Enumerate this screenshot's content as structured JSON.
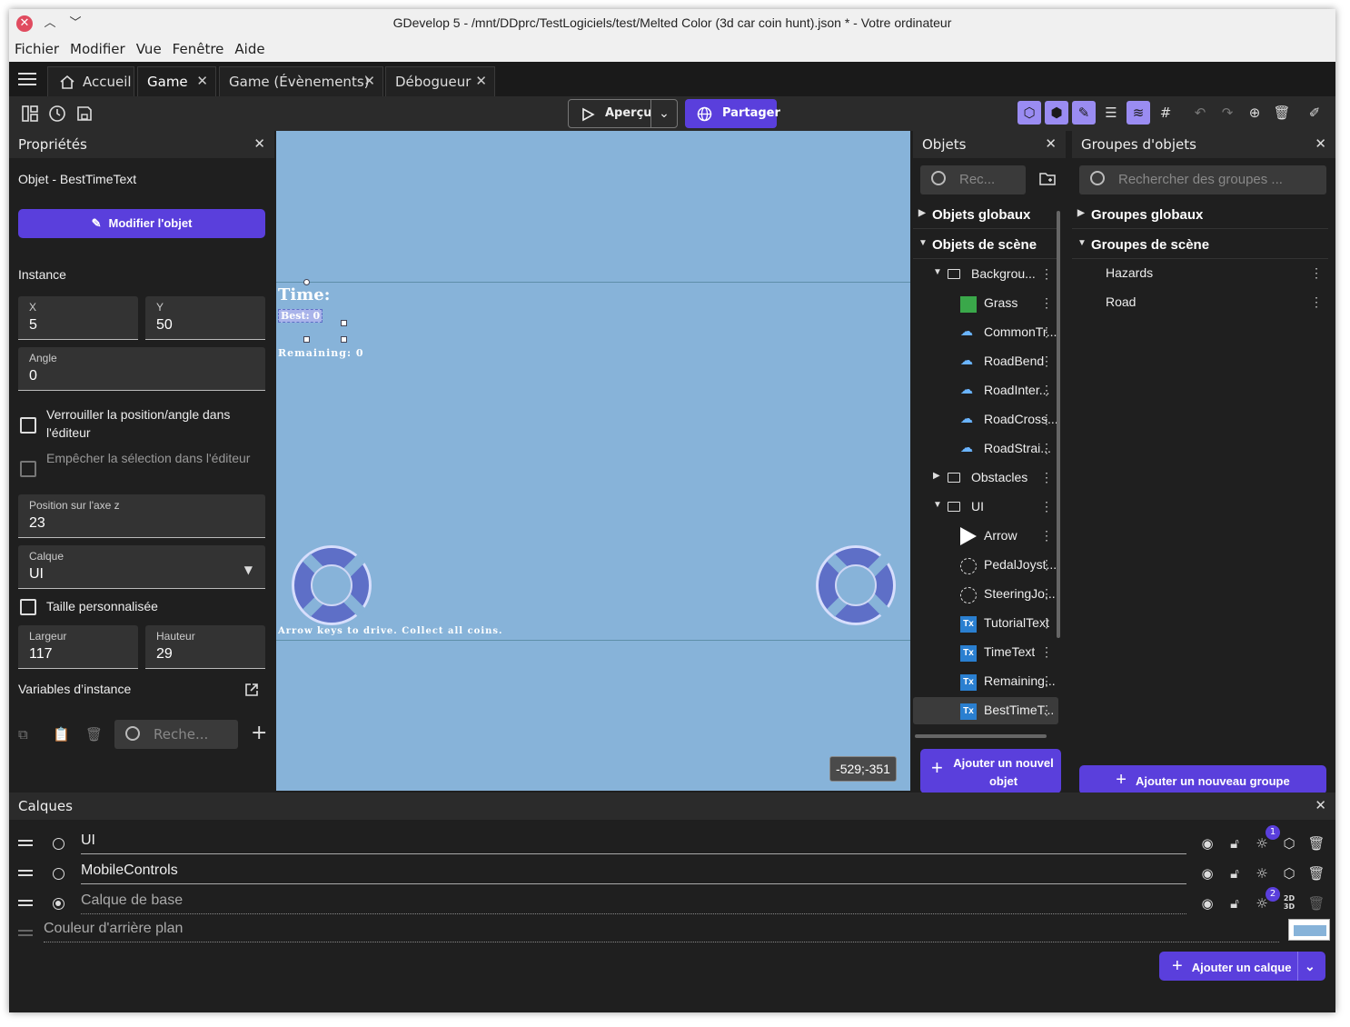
{
  "window": {
    "title": "GDevelop 5 - /mnt/DDprc/TestLogiciels/test/Melted Color (3d car coin hunt).json * - Votre ordinateur"
  },
  "menu": [
    "Fichier",
    "Modifier",
    "Vue",
    "Fenêtre",
    "Aide"
  ],
  "tabs": [
    {
      "label": "Accueil"
    },
    {
      "label": "Game"
    },
    {
      "label": "Game (Évènements)"
    },
    {
      "label": "Débogueur"
    }
  ],
  "toolbar": {
    "preview_label": "Aperçu",
    "share_label": "Partager"
  },
  "properties": {
    "header": "Propriétés",
    "object_line": "Objet  - BestTimeText",
    "edit_object_label": "Modifier l'objet",
    "instance_label": "Instance",
    "x_label": "X",
    "x_value": "5",
    "y_label": "Y",
    "y_value": "50",
    "angle_label": "Angle",
    "angle_value": "0",
    "lock_label": "Verrouiller la position/angle dans l'éditeur",
    "prevent_select_label": "Empêcher la sélection dans l'éditeur",
    "z_label": "Position sur l'axe z",
    "z_value": "23",
    "layer_label": "Calque",
    "layer_value": "UI",
    "custom_size_label": "Taille personnalisée",
    "width_label": "Largeur",
    "width_value": "117",
    "height_label": "Hauteur",
    "height_value": "29",
    "instance_vars_label": "Variables d’instance",
    "search_placeholder": "Reche..."
  },
  "canvas": {
    "time_text": "Time:",
    "best_text": "Best: 0",
    "remaining_text": "Remaining: 0",
    "tutorial_text": "Arrow keys to drive. Collect all coins.",
    "coords": "-529;-351",
    "background_color": "#87b3d9"
  },
  "objects": {
    "header": "Objets",
    "search_placeholder": "Rec...",
    "global_label": "Objets globaux",
    "scene_label": "Objets de scène",
    "items": [
      {
        "label": "Backgrou...",
        "kind": "folder"
      },
      {
        "label": "Grass",
        "kind": "grass-icon"
      },
      {
        "label": "CommonTr...",
        "kind": "model-icon"
      },
      {
        "label": "RoadBend",
        "kind": "model-icon"
      },
      {
        "label": "RoadInter...",
        "kind": "model-icon"
      },
      {
        "label": "RoadCross...",
        "kind": "model-icon"
      },
      {
        "label": "RoadStrai...",
        "kind": "model-icon"
      },
      {
        "label": "Obstacles",
        "kind": "folder"
      },
      {
        "label": "UI",
        "kind": "folder"
      },
      {
        "label": "Arrow",
        "kind": "arrow-icon"
      },
      {
        "label": "PedalJoyst...",
        "kind": "joystick-icon"
      },
      {
        "label": "SteeringJo...",
        "kind": "joystick-icon"
      },
      {
        "label": "TutorialText",
        "kind": "text-icon"
      },
      {
        "label": "TimeText",
        "kind": "text-icon"
      },
      {
        "label": "Remaining...",
        "kind": "text-icon"
      },
      {
        "label": "BestTimeT...",
        "kind": "text-icon"
      }
    ],
    "add_label_1": "Ajouter un nouvel",
    "add_label_2": "objet"
  },
  "groups": {
    "header": "Groupes d'objets",
    "search_placeholder": "Rechercher des groupes ...",
    "global_label": "Groupes globaux",
    "scene_label": "Groupes de scène",
    "items": [
      {
        "label": "Hazards"
      },
      {
        "label": "Road"
      }
    ],
    "add_label": "Ajouter un nouveau groupe"
  },
  "layers": {
    "header": "Calques",
    "items": [
      {
        "name": "UI",
        "badge": "1"
      },
      {
        "name": "MobileControls",
        "badge": ""
      },
      {
        "name": "Calque de base",
        "badge": "2"
      }
    ],
    "bg_color_label": "Couleur d'arrière plan",
    "add_label": "Ajouter un calque",
    "mode_2d3d": "2D 3D"
  },
  "colors": {
    "accent": "#5a3fdc",
    "panel_bg": "#1f1f1f",
    "canvas_bg": "#87b3d9"
  }
}
